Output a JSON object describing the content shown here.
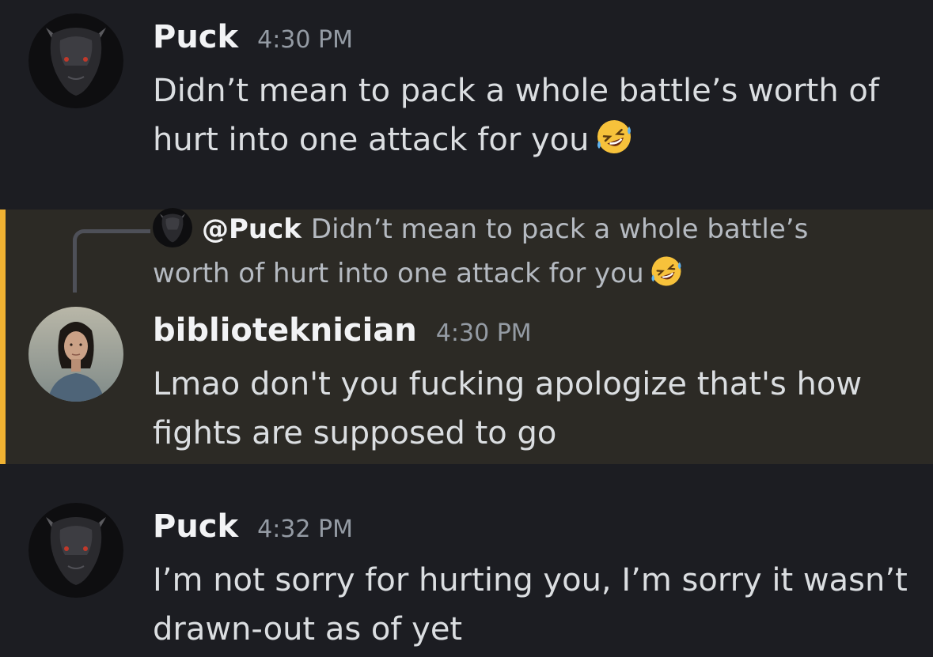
{
  "messages": [
    {
      "author": "Puck",
      "time": "4:30 PM",
      "text": "Didn’t mean to pack a whole battle’s worth of hurt into one attack for you",
      "emoji": "rolling-on-floor-laughing"
    },
    {
      "author": "biblioteknician",
      "time": "4:30 PM",
      "text": "Lmao don't you fucking apologize that's how fights are supposed to go",
      "reply": {
        "mention": "@Puck",
        "text": "Didn’t mean to pack a whole battle’s worth of hurt into one attack for you",
        "emoji": "rolling-on-floor-laughing"
      }
    },
    {
      "author": "Puck",
      "time": "4:32 PM",
      "text": "I’m not sorry for hurting you, I’m sorry it wasn’t drawn-out as of yet"
    }
  ],
  "colors": {
    "background": "#1c1d22",
    "mention_highlight": "#2c2a25",
    "mention_bar": "#f0b232",
    "username": "#f2f3f5",
    "timestamp": "#949ba4",
    "text": "#dbdee1"
  }
}
